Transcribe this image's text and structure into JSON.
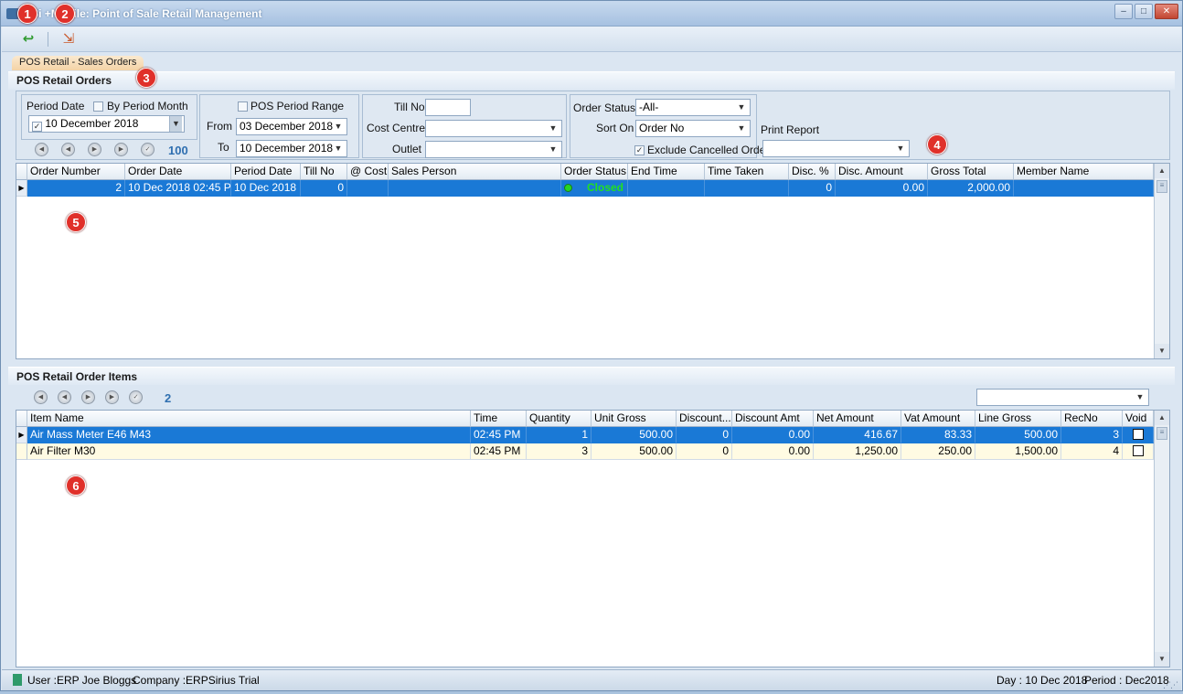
{
  "window": {
    "title": "ERP Sirius+Mobile: Point of Sale Retail Management",
    "title_visible": "P Si       +Mobile: Point of Sale Retail Management",
    "minimize": "–",
    "maximize": "□",
    "close": "✕"
  },
  "toolbar": {
    "back_icon": "↩",
    "exit_icon": "⇲"
  },
  "tab": {
    "label": "POS Retail - Sales Orders"
  },
  "orders_section": {
    "title": "POS Retail Orders",
    "filters": {
      "period_date_label": "Period Date",
      "by_period_month_label": "By Period Month",
      "by_period_month_checked": false,
      "period_date_checked": true,
      "period_date_value": "10 December 2018",
      "pos_period_range_label": "POS Period Range",
      "pos_period_range_checked": false,
      "from_label": "From",
      "from_value": "03 December 2018",
      "to_label": "To",
      "to_value": "10 December 2018",
      "till_no_label": "Till No",
      "till_no_value": "",
      "cost_centre_label": "Cost Centre",
      "cost_centre_value": "",
      "outlet_label": "Outlet",
      "outlet_value": "",
      "order_status_label": "Order Status",
      "order_status_value": "-All-",
      "sort_on_label": "Sort On",
      "sort_on_value": "Order No",
      "exclude_cancelled_label": "Exclude Cancelled Order",
      "exclude_cancelled_checked": true,
      "print_report_label": "Print Report",
      "print_report_value": "",
      "nav_count": "100"
    },
    "columns": [
      "Order Number",
      "Order Date",
      "Period Date",
      "Till No",
      "@ Cost",
      "Sales Person",
      "Order Status",
      "End Time",
      "Time Taken",
      "Disc. %",
      "Disc. Amount",
      "Gross Total",
      "Member Name"
    ],
    "rows": [
      {
        "order_number": "2",
        "order_date": "10 Dec 2018 02:45 PM",
        "period_date": "10 Dec 2018",
        "till_no": "0",
        "cost": "",
        "sales_person": "",
        "order_status": "Closed",
        "end_time": "",
        "time_taken": "",
        "disc_pct": "0",
        "disc_amount": "0.00",
        "gross_total": "2,000.00",
        "member_name": ""
      }
    ]
  },
  "items_section": {
    "title": "POS Retail Order Items",
    "nav_count": "2",
    "filter_value": "",
    "columns": [
      "Item Name",
      "Time",
      "Quantity",
      "Unit Gross",
      "Discount...",
      "Discount Amt",
      "Net Amount",
      "Vat Amount",
      "Line Gross",
      "RecNo",
      "Void"
    ],
    "rows": [
      {
        "item_name": "Air Mass Meter E46 M43",
        "time": "02:45 PM",
        "quantity": "1",
        "unit_gross": "500.00",
        "discount_pct": "0",
        "discount_amt": "0.00",
        "net_amount": "416.67",
        "vat_amount": "83.33",
        "line_gross": "500.00",
        "recno": "3",
        "void": false
      },
      {
        "item_name": "Air Filter M30",
        "time": "02:45 PM",
        "quantity": "3",
        "unit_gross": "500.00",
        "discount_pct": "0",
        "discount_amt": "0.00",
        "net_amount": "1,250.00",
        "vat_amount": "250.00",
        "line_gross": "1,500.00",
        "recno": "4",
        "void": false
      }
    ]
  },
  "statusbar": {
    "user": "User :ERP Joe Bloggs",
    "company": "Company :ERPSirius Trial",
    "day": "Day : 10 Dec 2018",
    "period": "Period : Dec2018"
  },
  "badges": [
    "1",
    "2",
    "3",
    "4",
    "5",
    "6"
  ],
  "colors": {
    "selection": "#1a79d6",
    "status_closed": "#21e021",
    "badge": "#e0302a",
    "alt_row": "#fffbe3"
  },
  "icons": [
    "app-icon",
    "back-icon",
    "exit-icon",
    "dropdown-arrow-icon",
    "first-icon",
    "prev-icon",
    "next-icon",
    "last-icon",
    "refresh-icon",
    "status-dot-icon",
    "row-indicator-icon",
    "scroll-up-icon",
    "scroll-down-icon"
  ]
}
